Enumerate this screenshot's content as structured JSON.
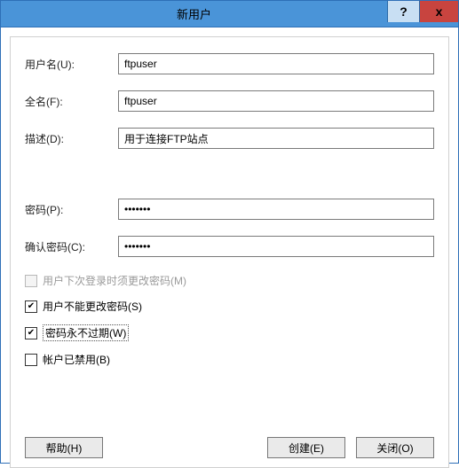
{
  "window": {
    "title": "新用户",
    "help_symbol": "?",
    "close_symbol": "x"
  },
  "fields": {
    "username": {
      "label": "用户名(U):",
      "value": "ftpuser"
    },
    "fullname": {
      "label": "全名(F):",
      "value": "ftpuser"
    },
    "description": {
      "label": "描述(D):",
      "value": "用于连接FTP站点"
    },
    "password": {
      "label": "密码(P):",
      "value": "•••••••"
    },
    "confirm": {
      "label": "确认密码(C):",
      "value": "•••••••"
    }
  },
  "checkboxes": {
    "must_change": {
      "label": "用户下次登录时须更改密码(M)",
      "checked": false,
      "disabled": true
    },
    "cannot_change": {
      "label": "用户不能更改密码(S)",
      "checked": true,
      "disabled": false
    },
    "never_expires": {
      "label": "密码永不过期(W)",
      "checked": true,
      "disabled": false,
      "focused": true
    },
    "disabled_acct": {
      "label": "帐户已禁用(B)",
      "checked": false,
      "disabled": false
    }
  },
  "buttons": {
    "help": "帮助(H)",
    "create": "创建(E)",
    "close": "关闭(O)"
  }
}
